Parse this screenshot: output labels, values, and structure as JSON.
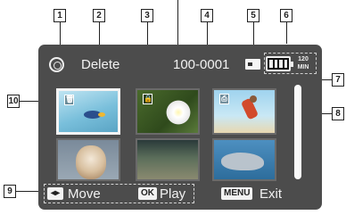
{
  "header": {
    "mode_icon": "photo-mode-icon",
    "title": "Delete",
    "file_number": "100-0001",
    "storage_icon": "memory-card-icon",
    "battery_icon": "battery-icon",
    "remaining_time": "120\nMIN"
  },
  "thumbnails": [
    {
      "icon": "trash-icon",
      "icon_text": "🗑",
      "selected": true,
      "scene": "fish-underwater"
    },
    {
      "icon": "lock-icon",
      "icon_text": "🔒",
      "selected": false,
      "scene": "white-flower"
    },
    {
      "icon": "print-icon",
      "icon_text": "⎙",
      "selected": false,
      "scene": "jumping-person"
    },
    {
      "icon": "",
      "icon_text": "",
      "selected": false,
      "scene": "puppy"
    },
    {
      "icon": "",
      "icon_text": "",
      "selected": false,
      "scene": "landscape"
    },
    {
      "icon": "",
      "icon_text": "",
      "selected": false,
      "scene": "dolphin"
    }
  ],
  "footer": {
    "move_icon": "joystick-icon",
    "move_label": "Move",
    "ok_tag": "OK",
    "play_label": "Play",
    "menu_tag": "MENU",
    "exit_label": "Exit"
  },
  "callouts": [
    "1",
    "2",
    "3",
    "4",
    "5",
    "6",
    "7",
    "8",
    "9",
    "10"
  ]
}
